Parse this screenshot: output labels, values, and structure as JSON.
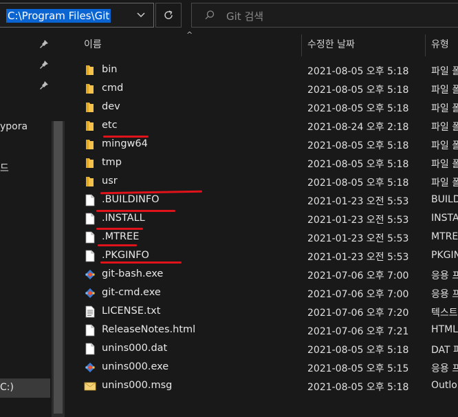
{
  "address_bar": {
    "path": "C:\\Program Files\\Git"
  },
  "search": {
    "placeholder": "Git 검색"
  },
  "nav": {
    "items": [
      {
        "label": "ypora"
      },
      {
        "label": "드"
      }
    ],
    "selected_label": "C:)"
  },
  "columns": {
    "name": "이름",
    "modified": "수정한 날짜",
    "type": "유형"
  },
  "files": [
    {
      "name": "bin",
      "date": "2021-08-05 오후 5:18",
      "type": "파일 폴",
      "icon": "folder-icon"
    },
    {
      "name": "cmd",
      "date": "2021-08-05 오후 5:18",
      "type": "파일 폴",
      "icon": "folder-icon"
    },
    {
      "name": "dev",
      "date": "2021-08-05 오후 5:18",
      "type": "파일 폴",
      "icon": "folder-icon"
    },
    {
      "name": "etc",
      "date": "2021-08-24 오후 2:18",
      "type": "파일 폴",
      "icon": "folder-icon"
    },
    {
      "name": "mingw64",
      "date": "2021-08-05 오후 5:18",
      "type": "파일 폴",
      "icon": "folder-icon"
    },
    {
      "name": "tmp",
      "date": "2021-08-05 오후 5:18",
      "type": "파일 폴",
      "icon": "folder-icon"
    },
    {
      "name": "usr",
      "date": "2021-08-05 오후 5:18",
      "type": "파일 폴",
      "icon": "folder-icon"
    },
    {
      "name": ".BUILDINFO",
      "date": "2021-01-23 오전 5:53",
      "type": "BUILD",
      "icon": "document-icon"
    },
    {
      "name": ".INSTALL",
      "date": "2021-01-23 오전 5:53",
      "type": "INSTA",
      "icon": "document-icon"
    },
    {
      "name": ".MTREE",
      "date": "2021-01-23 오전 5:53",
      "type": "MTRE",
      "icon": "document-icon"
    },
    {
      "name": ".PKGINFO",
      "date": "2021-01-23 오전 5:53",
      "type": "PKGIN",
      "icon": "document-icon"
    },
    {
      "name": "git-bash.exe",
      "date": "2021-07-06 오후 7:00",
      "type": "응용 프",
      "icon": "git-icon"
    },
    {
      "name": "git-cmd.exe",
      "date": "2021-07-06 오후 7:00",
      "type": "응용 프",
      "icon": "git-icon"
    },
    {
      "name": "LICENSE.txt",
      "date": "2021-07-06 오후 7:20",
      "type": "텍스트",
      "icon": "text-file-icon"
    },
    {
      "name": "ReleaseNotes.html",
      "date": "2021-07-06 오후 7:21",
      "type": "HTML",
      "icon": "document-icon"
    },
    {
      "name": "unins000.dat",
      "date": "2021-08-05 오후 5:18",
      "type": "DAT 파",
      "icon": "document-icon"
    },
    {
      "name": "unins000.exe",
      "date": "2021-08-05 오후 5:15",
      "type": "응용 프",
      "icon": "git-icon"
    },
    {
      "name": "unins000.msg",
      "date": "2021-08-05 오후 5:18",
      "type": "Outlo",
      "icon": "mail-icon"
    }
  ],
  "colors": {
    "annotation": "#e0131a",
    "folder": "#f4c14a",
    "selection": "#0a64d2"
  }
}
